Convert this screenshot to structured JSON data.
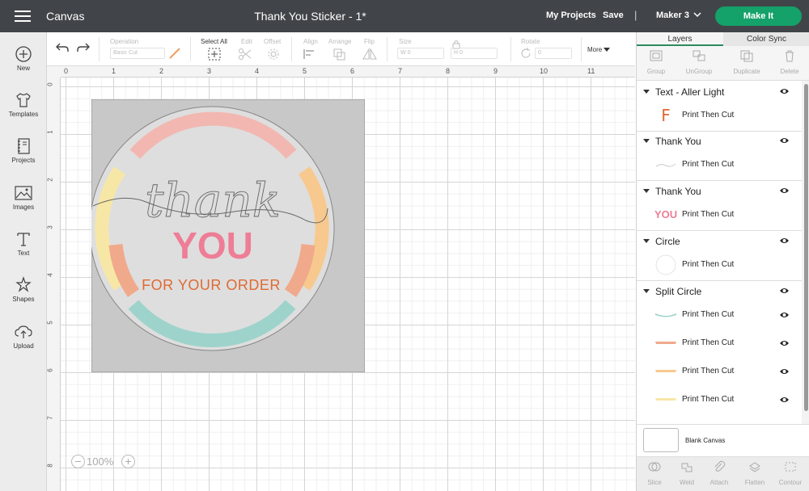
{
  "header": {
    "app_title": "Canvas",
    "doc_title": "Thank You Sticker - 1*",
    "my_projects": "My Projects",
    "save": "Save",
    "separator": "|",
    "machine": "Maker 3",
    "make_it": "Make It",
    "accent_color": "#15a16a"
  },
  "sidebar": {
    "items": [
      {
        "label": "New",
        "icon": "plus-circle-icon"
      },
      {
        "label": "Templates",
        "icon": "shirt-icon"
      },
      {
        "label": "Projects",
        "icon": "notebook-icon"
      },
      {
        "label": "Images",
        "icon": "image-icon"
      },
      {
        "label": "Text",
        "icon": "text-t-icon"
      },
      {
        "label": "Shapes",
        "icon": "shapes-icon"
      },
      {
        "label": "Upload",
        "icon": "cloud-upload-icon"
      }
    ]
  },
  "toolbar": {
    "operation_label": "Operation",
    "operation_value": "Basic Cut",
    "select_all": "Select All",
    "edit": "Edit",
    "offset": "Offset",
    "align": "Align",
    "arrange": "Arrange",
    "flip": "Flip",
    "size": "Size",
    "w_label": "W",
    "w_value": "0",
    "h_label": "H",
    "h_value": "0",
    "rotate": "Rotate",
    "rotate_value": "0",
    "more": "More"
  },
  "canvas": {
    "ruler_top": [
      "0",
      "1",
      "2",
      "3",
      "4",
      "5",
      "6",
      "7",
      "8",
      "9",
      "10",
      "11"
    ],
    "ruler_left": [
      "0",
      "1",
      "2",
      "3",
      "4",
      "5",
      "6",
      "7",
      "8"
    ],
    "zoom_out": "−",
    "zoom_in": "+",
    "zoom_value": "100%",
    "design": {
      "script_text": "thank",
      "you_text": "YOU",
      "order_text": "FOR YOUR ORDER",
      "colors": {
        "pink": "#f2b7b1",
        "yellow": "#f7e7a6",
        "orange": "#f7c98e",
        "salmon": "#f0a98b",
        "teal": "#9ed3cb",
        "you": "#ee7d95",
        "order": "#e06a33"
      }
    }
  },
  "panel": {
    "tab_layers": "Layers",
    "tab_color_sync": "Color Sync",
    "actions": [
      "Group",
      "UnGroup",
      "Duplicate",
      "Delete"
    ],
    "groups": [
      {
        "name": "Text - Aller Light",
        "rows": [
          {
            "label": "Print Then Cut",
            "thumb": "letter-f"
          }
        ]
      },
      {
        "name": "Thank You",
        "rows": [
          {
            "label": "Print Then Cut",
            "thumb": "script"
          }
        ]
      },
      {
        "name": "Thank You",
        "rows": [
          {
            "label": "Print Then Cut",
            "thumb": "you"
          }
        ]
      },
      {
        "name": "Circle",
        "rows": [
          {
            "label": "Print Then Cut",
            "thumb": "circle"
          }
        ]
      },
      {
        "name": "Split Circle",
        "rows": [
          {
            "label": "Print Then Cut",
            "thumb": "arc-teal"
          },
          {
            "label": "Print Then Cut",
            "thumb": "arc-salmon"
          },
          {
            "label": "Print Then Cut",
            "thumb": "arc-orange"
          },
          {
            "label": "Print Then Cut",
            "thumb": "arc-yellow"
          }
        ]
      }
    ],
    "thumb_f": "F",
    "thumb_you": "YOU",
    "blank_canvas": "Blank Canvas",
    "bottom_actions": [
      "Slice",
      "Weld",
      "Attach",
      "Flatten",
      "Contour"
    ]
  }
}
